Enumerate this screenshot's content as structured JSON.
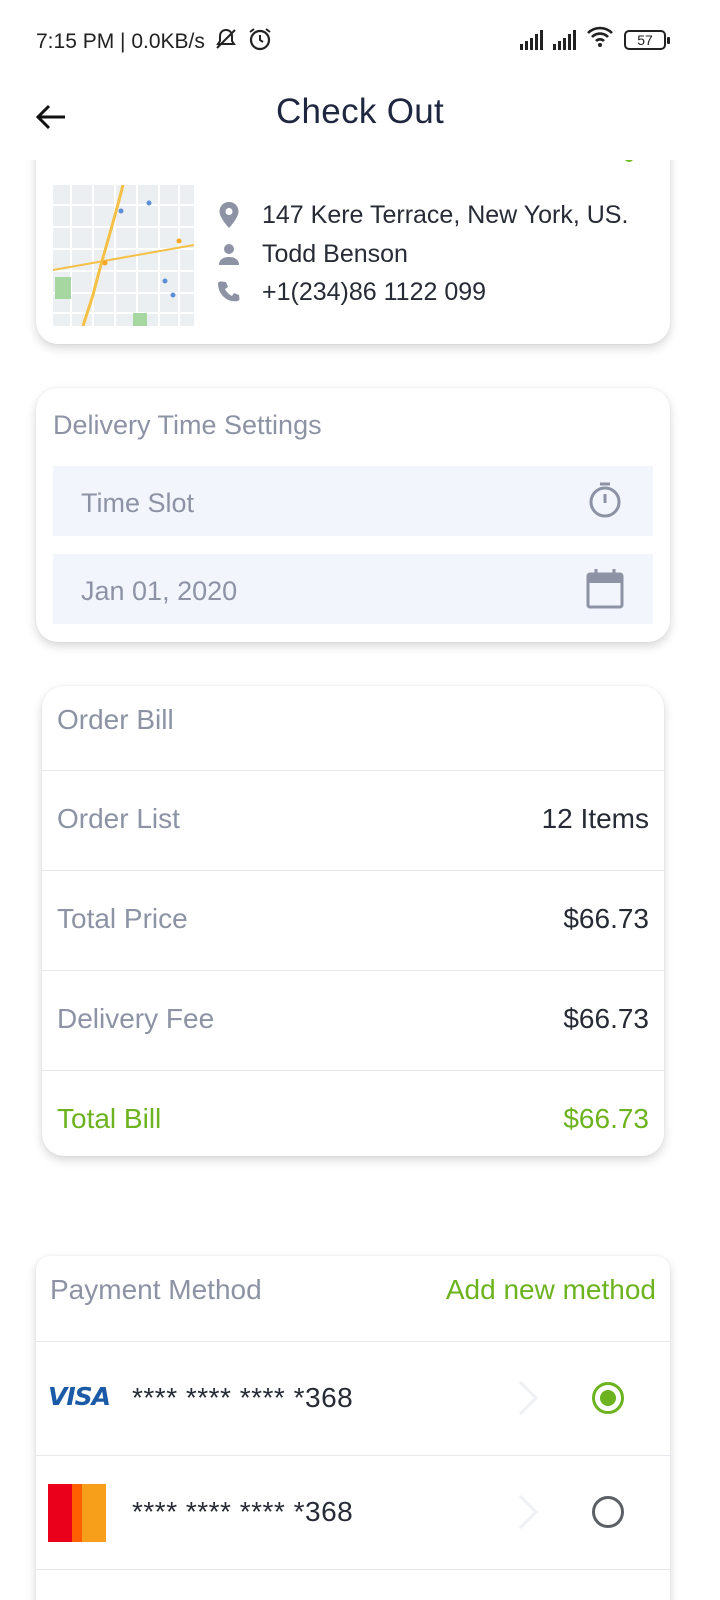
{
  "status_bar": {
    "time_text": "7:15 PM | 0.0KB/s",
    "battery": "57",
    "icons": [
      "muted-bell-icon",
      "alarm-icon",
      "signal-icon",
      "signal-icon",
      "wifi-icon",
      "battery-icon"
    ]
  },
  "header": {
    "title": "Check Out",
    "back_icon": "arrow-left-icon"
  },
  "address": {
    "street": "147 Kere Terrace, New York, US.",
    "name": "Todd Benson",
    "phone": "+1(234)86 1122 099",
    "icons": [
      "location-pin-icon",
      "person-icon",
      "phone-icon"
    ]
  },
  "delivery_time": {
    "title": "Delivery Time Settings",
    "time_slot_label": "Time Slot",
    "date_label": "Jan 01, 2020",
    "icons": [
      "stopwatch-icon",
      "calendar-icon"
    ]
  },
  "order_bill": {
    "title": "Order Bill",
    "rows": [
      {
        "label": "Order List",
        "value": "12 Items"
      },
      {
        "label": "Total Price",
        "value": "$66.73"
      },
      {
        "label": "Delivery Fee",
        "value": "$66.73"
      },
      {
        "label": "Total Bill",
        "value": "$66.73"
      }
    ]
  },
  "payment": {
    "title": "Payment Method",
    "add_label": "Add new method",
    "methods": [
      {
        "brand": "VISA",
        "number": "**** **** **** *368",
        "selected": true
      },
      {
        "brand": "mastercard",
        "number": "**** **** **** *368",
        "selected": false
      }
    ]
  },
  "colors": {
    "accent_green": "#6cb31f",
    "muted_text": "#8d93a5",
    "field_bg": "#f2f5fc",
    "visa_blue": "#1a5aa6",
    "mastercard_red": "#eb001b",
    "mastercard_orange": "#f79e1b"
  }
}
